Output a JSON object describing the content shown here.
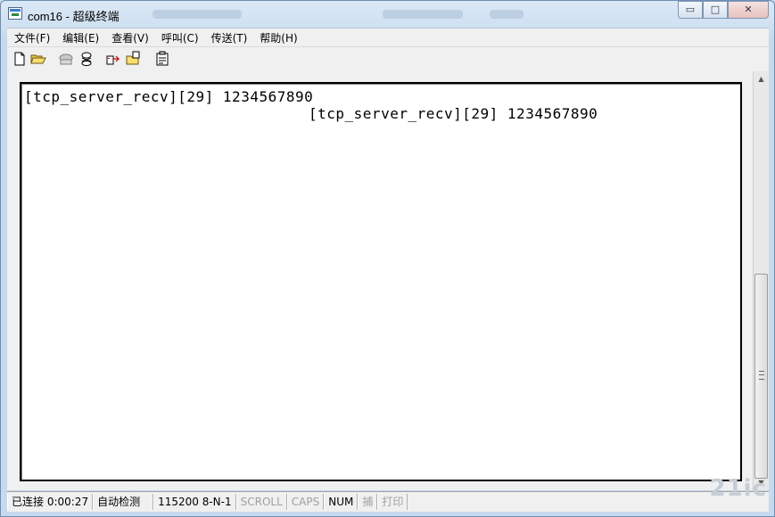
{
  "window": {
    "title": "com16 - 超级终端",
    "caption_buttons": {
      "minimize": "▭",
      "maximize": "□",
      "close": "✕"
    }
  },
  "menu": [
    "文件(F)",
    "编辑(E)",
    "查看(V)",
    "呼叫(C)",
    "传送(T)",
    "帮助(H)"
  ],
  "toolbar": {
    "icons": [
      "new-file-icon",
      "open-folder-icon",
      "phone-disconnected-icon",
      "call-icon",
      "send-icon",
      "receive-icon",
      "properties-icon"
    ]
  },
  "terminal": {
    "lines": [
      "[tcp_server_recv][29] 1234567890",
      "[tcp_server_recv][29] 1234567890"
    ]
  },
  "status": {
    "connection": "已连接 0:00:27",
    "detect": "自动检测",
    "port_settings": "115200 8-N-1",
    "scroll": "SCROLL",
    "caps": "CAPS",
    "num": "NUM",
    "capture": "捕",
    "print": "打印"
  },
  "watermark": "21ic"
}
